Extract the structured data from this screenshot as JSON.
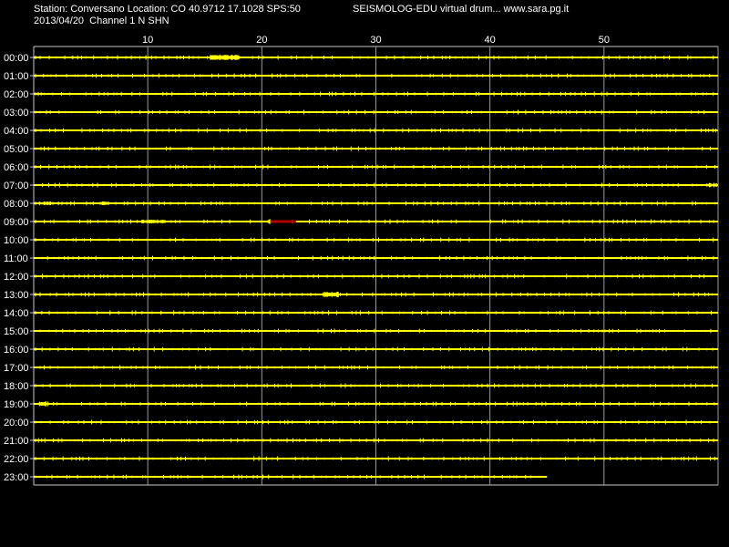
{
  "header": {
    "station_line": "Station: Conversano Location: CO 40.9712 17.1028 SPS:50",
    "brand_line": "SEISMOLOG-EDU virtual drum... www.sara.pg.it",
    "date_line": "2013/04/20  Channel 1 N SHN"
  },
  "x_axis": {
    "tick_labels": [
      "10",
      "20",
      "30",
      "40",
      "50"
    ],
    "tick_values": [
      10,
      20,
      30,
      40,
      50
    ],
    "range": [
      0,
      60
    ]
  },
  "rows": [
    {
      "label": "00:00",
      "end": 60,
      "events": [
        {
          "pos": 15.5,
          "w": 2.5,
          "amp": 3
        }
      ]
    },
    {
      "label": "01:00",
      "end": 60,
      "events": []
    },
    {
      "label": "02:00",
      "end": 60,
      "events": []
    },
    {
      "label": "03:00",
      "end": 60,
      "events": []
    },
    {
      "label": "04:00",
      "end": 60,
      "events": []
    },
    {
      "label": "05:00",
      "end": 60,
      "events": [
        {
          "pos": 11,
          "w": 0.6,
          "amp": 1
        }
      ]
    },
    {
      "label": "06:00",
      "end": 60,
      "events": []
    },
    {
      "label": "07:00",
      "end": 60,
      "events": [
        {
          "pos": 59,
          "w": 1,
          "amp": 2
        }
      ]
    },
    {
      "label": "08:00",
      "end": 60,
      "events": [
        {
          "pos": 0.5,
          "w": 1.2,
          "amp": 2
        },
        {
          "pos": 6,
          "w": 0.6,
          "amp": 2
        }
      ]
    },
    {
      "label": "09:00",
      "end": 60,
      "events": [
        {
          "pos": 9.5,
          "w": 2,
          "amp": 2
        },
        {
          "pos": 13.5,
          "w": 0.3,
          "amp": 1
        }
      ]
    },
    {
      "label": "10:00",
      "end": 60,
      "events": []
    },
    {
      "label": "11:00",
      "end": 60,
      "events": []
    },
    {
      "label": "12:00",
      "end": 60,
      "events": []
    },
    {
      "label": "13:00",
      "end": 60,
      "events": [
        {
          "pos": 25.5,
          "w": 1.2,
          "amp": 3
        }
      ]
    },
    {
      "label": "14:00",
      "end": 60,
      "events": []
    },
    {
      "label": "15:00",
      "end": 60,
      "events": []
    },
    {
      "label": "16:00",
      "end": 60,
      "events": []
    },
    {
      "label": "17:00",
      "end": 60,
      "events": [
        {
          "pos": 1.5,
          "w": 2,
          "amp": 1
        }
      ]
    },
    {
      "label": "18:00",
      "end": 60,
      "events": []
    },
    {
      "label": "19:00",
      "end": 60,
      "events": [
        {
          "pos": 0.5,
          "w": 0.6,
          "amp": 3
        }
      ]
    },
    {
      "label": "20:00",
      "end": 60,
      "events": []
    },
    {
      "label": "21:00",
      "end": 60,
      "events": []
    },
    {
      "label": "22:00",
      "end": 60,
      "events": []
    },
    {
      "label": "23:00",
      "end": 45,
      "events": []
    }
  ],
  "marker": {
    "row": 9,
    "start": 20.5,
    "end": 23,
    "color": "#b00000"
  },
  "colors": {
    "background": "#000000",
    "trace": "#ffff00",
    "grid": "#9a9a9a",
    "frame": "#c8c8c8",
    "text": "#ffffff"
  }
}
